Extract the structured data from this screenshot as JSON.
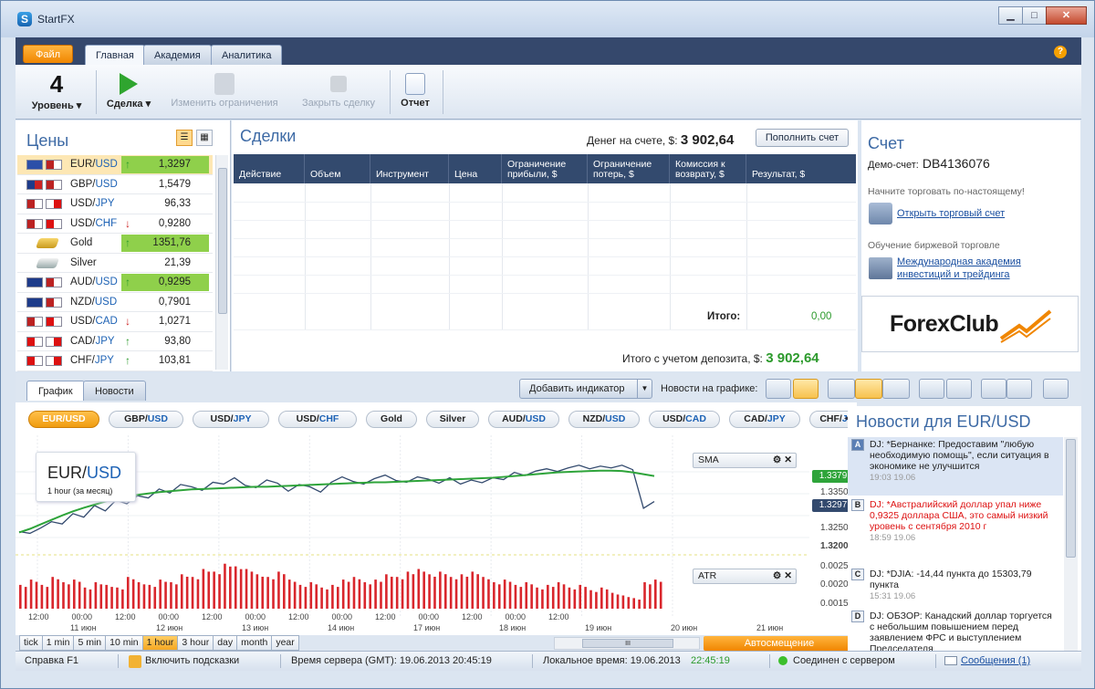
{
  "window": {
    "title": "StartFX",
    "minimize": "▁",
    "maximize": "□",
    "close": "✕"
  },
  "ribbon_tabs": [
    "Файл",
    "Главная",
    "Академия",
    "Аналитика"
  ],
  "help": "?",
  "ribbon": {
    "level_value": "4",
    "level_label": "Уровень ▾",
    "deal_label": "Сделка ▾",
    "change_limits": "Изменить ограничения",
    "close_deal": "Закрыть сделку",
    "report": "Отчет"
  },
  "prices": {
    "title": "Цены",
    "rows": [
      {
        "sym": "EUR",
        "quote": "USD",
        "arrow": "↑",
        "dir": "up",
        "value": "1,3297",
        "hl": "#8fd04b"
      },
      {
        "sym": "GBP",
        "quote": "USD",
        "arrow": "",
        "dir": "",
        "value": "1,5479",
        "hl": ""
      },
      {
        "sym": "USD",
        "quote": "JPY",
        "arrow": "",
        "dir": "",
        "value": "96,33",
        "hl": ""
      },
      {
        "sym": "USD",
        "quote": "CHF",
        "arrow": "↓",
        "dir": "dn",
        "value": "0,9280",
        "hl": ""
      },
      {
        "sym": "Gold",
        "quote": "",
        "arrow": "↑",
        "dir": "up",
        "value": "1351,76",
        "hl": "#8fd04b"
      },
      {
        "sym": "Silver",
        "quote": "",
        "arrow": "",
        "dir": "",
        "value": "21,39",
        "hl": ""
      },
      {
        "sym": "AUD",
        "quote": "USD",
        "arrow": "↑",
        "dir": "up",
        "value": "0,9295",
        "hl": "#8fd04b"
      },
      {
        "sym": "NZD",
        "quote": "USD",
        "arrow": "",
        "dir": "",
        "value": "0,7901",
        "hl": ""
      },
      {
        "sym": "USD",
        "quote": "CAD",
        "arrow": "↓",
        "dir": "dn",
        "value": "1,0271",
        "hl": ""
      },
      {
        "sym": "CAD",
        "quote": "JPY",
        "arrow": "↑",
        "dir": "up",
        "value": "93,80",
        "hl": ""
      },
      {
        "sym": "CHF",
        "quote": "JPY",
        "arrow": "↑",
        "dir": "up",
        "value": "103,81",
        "hl": ""
      }
    ]
  },
  "deals": {
    "title": "Сделки",
    "balance_label": "Денег на счете, $:",
    "balance_value": "3 902,64",
    "topup": "Пополнить счет",
    "columns": [
      "Действие",
      "Объем",
      "Инструмент",
      "Цена",
      "Ограничение прибыли, $",
      "Ограничение потерь, $",
      "Комиссия к возврату, $",
      "Результат, $"
    ],
    "total_label": "Итого:",
    "total_value": "0,00",
    "deposit_label": "Итого с учетом депозита, $:",
    "deposit_value": "3 902,64"
  },
  "account": {
    "title": "Счет",
    "demo_label": "Демо-счет:",
    "demo_id": "DB4136076",
    "real_note": "Начните торговать по-настоящему!",
    "open_link": "Открыть торговый счет",
    "edu_note": "Обучение биржевой торговле",
    "academy_link": "Международная академия инвестиций и трейдинга",
    "logo": "ForexClub"
  },
  "lower": {
    "tabs": [
      "График",
      "Новости"
    ],
    "add_indicator": "Добавить индикатор",
    "news_on_chart": "Новости на графике:",
    "pairs": [
      [
        "EUR",
        "USD"
      ],
      [
        "GBP",
        "USD"
      ],
      [
        "USD",
        "JPY"
      ],
      [
        "USD",
        "CHF"
      ],
      [
        "Gold",
        ""
      ],
      [
        "Silver",
        ""
      ],
      [
        "AUD",
        "USD"
      ],
      [
        "NZD",
        "USD"
      ],
      [
        "USD",
        "CAD"
      ],
      [
        "CAD",
        "JPY"
      ],
      [
        "CHF",
        "JP"
      ]
    ],
    "chart_title_base": "EUR",
    "chart_title_quote": "USD",
    "chart_period": "1 hour (за месяц)",
    "sma": "SMA",
    "atr": "ATR",
    "yticks_price": [
      "1.3379",
      "1.3350",
      "1.3297",
      "1.3250",
      "1.3200"
    ],
    "yticks_atr": [
      "0.0025",
      "0.0020",
      "0.0015"
    ],
    "xtimes": [
      "12:00",
      "00:00",
      "12:00",
      "00:00",
      "12:00",
      "00:00",
      "12:00",
      "00:00",
      "12:00",
      "00:00",
      "12:00",
      "00:00",
      "12:00"
    ],
    "xdays": [
      "11 июн",
      "12 июн",
      "13 июн",
      "14 июн",
      "17 июн",
      "18 июн",
      "19 июн",
      "20 июн",
      "21 июн"
    ],
    "timeframes": [
      "tick",
      "1 min",
      "5 min",
      "10 min",
      "1 hour",
      "3 hour",
      "day",
      "month",
      "year"
    ],
    "autoshift": "Автосмещение",
    "scroll_grip": "III"
  },
  "news": {
    "title": "Новости для EUR/USD",
    "items": [
      {
        "k": "A",
        "text": "DJ: *Бернанке: Предоставим \"любую необходимую помощь\", если ситуация в экономике не улучшится",
        "date": "19:03 19.06",
        "red": false
      },
      {
        "k": "B",
        "text": "DJ: *Австралийский доллар упал ниже 0,9325 доллара США, это самый низкий уровень с сентября 2010 г",
        "date": "18:59 19.06",
        "red": true
      },
      {
        "k": "C",
        "text": "DJ: *DJIA: -14,44 пункта до 15303,79 пункта",
        "date": "15:31 19.06",
        "red": false
      },
      {
        "k": "D",
        "text": "DJ: ОБЗОР: Канадский доллар торгуется с небольшим повышением перед заявлением ФРС и выступлением Председателя",
        "date": "",
        "red": false
      }
    ]
  },
  "status": {
    "help": "Справка F1",
    "tips": "Включить подсказки",
    "server_time": "Время сервера (GMT):  19.06.2013  20:45:19",
    "local_time_label": "Локальное время:  19.06.2013",
    "local_time": "22:45:19",
    "connected": "Соединен с сервером",
    "messages": "Сообщения (1)"
  },
  "colors": {
    "accent": "#f08600",
    "navy": "#334a6e",
    "green": "#2c9a2c",
    "price_line": "#334a6e",
    "sma_line": "#2ea43a",
    "atr_bar": "#d9262c"
  },
  "chart_data": {
    "type": "line",
    "series": [
      {
        "name": "EUR/USD",
        "values": [
          1.323,
          1.3226,
          1.3238,
          1.3252,
          1.3247,
          1.327,
          1.3262,
          1.3288,
          1.3276,
          1.33,
          1.3292,
          1.331,
          1.3305,
          1.3325,
          1.3316,
          1.3335,
          1.333,
          1.3322,
          1.334,
          1.3336,
          1.335,
          1.3333,
          1.3328,
          1.3345,
          1.3338,
          1.332,
          1.3335,
          1.333,
          1.3318,
          1.334,
          1.3352,
          1.3342,
          1.3336,
          1.3348,
          1.3356,
          1.3344,
          1.334,
          1.3352,
          1.3347,
          1.3338,
          1.335,
          1.3336,
          1.3345,
          1.3339,
          1.335,
          1.3346,
          1.3362,
          1.3355,
          1.3365,
          1.337,
          1.3364,
          1.3372,
          1.3378,
          1.337,
          1.3376,
          1.3372,
          1.3378,
          1.3368,
          1.3282,
          1.3297
        ]
      },
      {
        "name": "SMA",
        "values": [
          1.3228,
          1.3236,
          1.3246,
          1.3256,
          1.3266,
          1.3275,
          1.3283,
          1.329,
          1.3297,
          1.3303,
          1.3308,
          1.3312,
          1.3315,
          1.3318,
          1.332,
          1.3322,
          1.3324,
          1.3325,
          1.3326,
          1.3327,
          1.3328,
          1.3329,
          1.333,
          1.333,
          1.3331,
          1.3332,
          1.3333,
          1.3334,
          1.3335,
          1.3336,
          1.3337,
          1.3338,
          1.3339,
          1.334,
          1.334,
          1.3341,
          1.3342,
          1.3343,
          1.3344,
          1.3345,
          1.3346,
          1.3347,
          1.3348,
          1.3349,
          1.335,
          1.3352,
          1.3354,
          1.3356,
          1.3358,
          1.336,
          1.3362,
          1.3363,
          1.3364,
          1.3365,
          1.3366,
          1.3366,
          1.3365,
          1.3362,
          1.3358,
          1.3354
        ]
      },
      {
        "name": "ATR",
        "values": [
          0.0019,
          0.0021,
          0.0019,
          0.0022,
          0.002,
          0.0021,
          0.0018,
          0.002,
          0.0019,
          0.0018,
          0.0022,
          0.002,
          0.0019,
          0.0021,
          0.002,
          0.0023,
          0.0022,
          0.0025,
          0.0024,
          0.0027,
          0.0026,
          0.0025,
          0.0023,
          0.0022,
          0.0024,
          0.0021,
          0.0019,
          0.002,
          0.0018,
          0.0019,
          0.0021,
          0.0022,
          0.002,
          0.0021,
          0.0023,
          0.0022,
          0.0024,
          0.0025,
          0.0023,
          0.0024,
          0.0022,
          0.0023,
          0.0024,
          0.0022,
          0.002,
          0.0021,
          0.0019,
          0.002,
          0.0018,
          0.0019,
          0.002,
          0.0018,
          0.0019,
          0.0017,
          0.0018,
          0.0016,
          0.0015,
          0.0014,
          0.002,
          0.0021
        ]
      }
    ],
    "price_ylim": [
      1.318,
      1.34
    ],
    "atr_ylim": [
      0.001,
      0.003
    ],
    "grid": true
  }
}
